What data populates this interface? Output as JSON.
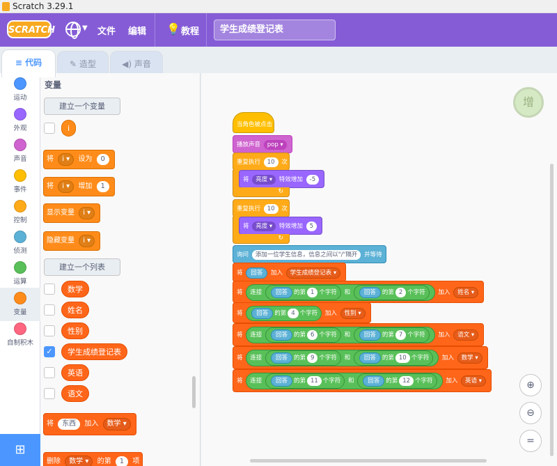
{
  "window": {
    "title": "Scratch 3.29.1"
  },
  "menubar": {
    "logo": "SCRATCH",
    "file": "文件",
    "edit": "编辑",
    "tutorials": "教程",
    "project_title": "学生成绩登记表"
  },
  "tabs": [
    {
      "label": "代码"
    },
    {
      "label": "造型"
    },
    {
      "label": "声音"
    }
  ],
  "categories": [
    {
      "label": "运动",
      "color": "#4c97ff"
    },
    {
      "label": "外观",
      "color": "#9966ff"
    },
    {
      "label": "声音",
      "color": "#cf63cf"
    },
    {
      "label": "事件",
      "color": "#ffbf00"
    },
    {
      "label": "控制",
      "color": "#ffab19"
    },
    {
      "label": "侦测",
      "color": "#5cb1d6"
    },
    {
      "label": "运算",
      "color": "#59c059"
    },
    {
      "label": "变量",
      "color": "#ff8c1a"
    },
    {
      "label": "自制积木",
      "color": "#ff6680"
    }
  ],
  "palette": {
    "title": "变量",
    "make_variable": "建立一个变量",
    "variable_name": "i",
    "set_block": {
      "prefix": "将",
      "var": "i",
      "mid": "设为",
      "value": "0"
    },
    "change_block": {
      "prefix": "将",
      "var": "i",
      "mid": "增加",
      "value": "1"
    },
    "show_block": {
      "text": "显示变量",
      "var": "i"
    },
    "hide_block": {
      "text": "隐藏变量",
      "var": "i"
    },
    "make_list": "建立一个列表",
    "lists": [
      "数学",
      "姓名",
      "性别",
      "学生成绩登记表",
      "英语",
      "语文"
    ],
    "add_block": {
      "prefix": "将",
      "thing": "东西",
      "mid": "加入",
      "list": "数学"
    },
    "delete_block": {
      "prefix": "删除",
      "list": "数学",
      "mid": "的第",
      "value": "1",
      "suffix": "项"
    }
  },
  "script": {
    "hat": "当角色被点击",
    "play_sound": {
      "text": "播放声音",
      "sound": "pop"
    },
    "repeat1": {
      "text": "重复执行",
      "times": "10",
      "suffix": "次"
    },
    "effect1": {
      "prefix": "将",
      "effect": "亮度",
      "mid": "特效增加",
      "value": "-5"
    },
    "repeat2": {
      "text": "重复执行",
      "times": "10",
      "suffix": "次"
    },
    "effect2": {
      "prefix": "将",
      "effect": "亮度",
      "mid": "特效增加",
      "value": "5"
    },
    "ask": {
      "prefix": "询问",
      "question": "添加一位学生信息，信息之间以\"/\"隔开",
      "suffix": "并等待"
    },
    "add_answer": {
      "prefix": "将",
      "answer": "回答",
      "mid": "加入",
      "list": "学生成绩登记表"
    },
    "join_rows": [
      {
        "a": "1",
        "b": "2",
        "list": "姓名"
      },
      {
        "a": "6",
        "b": "7",
        "list": "语文"
      },
      {
        "a": "9",
        "b": "10",
        "list": "数学"
      },
      {
        "a": "11",
        "b": "12",
        "list": "英语"
      }
    ],
    "letter_row": {
      "n": "4",
      "list": "性别"
    },
    "words": {
      "set": "将",
      "join": "连接",
      "answer": "回答",
      "of": "的第",
      "char": "个字符",
      "and": "和",
      "add": "加入"
    }
  },
  "workspace": {
    "sprite_badge": "增"
  },
  "icons": {
    "zoom_in": "zoom-in-icon",
    "zoom_out": "zoom-out-icon",
    "reset": "zoom-reset-icon"
  }
}
